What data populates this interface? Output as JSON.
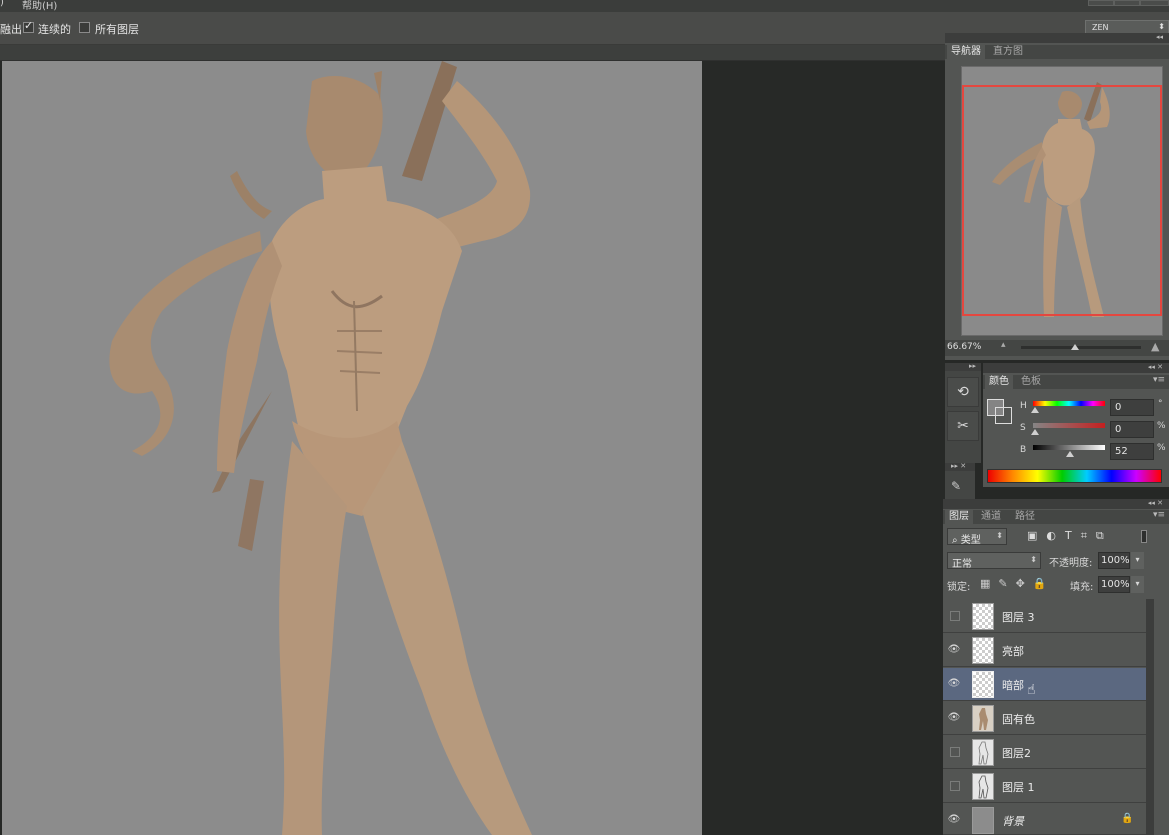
{
  "menubar": {
    "item_partial": ")",
    "help": "帮助(H)"
  },
  "options": {
    "partial": "融出",
    "contiguous": "连续的",
    "all_layers": "所有图层"
  },
  "workspace": "ZEN",
  "navigator": {
    "tab_navigator": "导航器",
    "tab_histogram": "直方图",
    "zoom": "66.67%"
  },
  "color_panel": {
    "tab_color": "颜色",
    "tab_swatches": "色板",
    "h_label": "H",
    "h_value": "0",
    "h_unit": "°",
    "s_label": "S",
    "s_value": "0",
    "s_unit": "%",
    "b_label": "B",
    "b_value": "52",
    "b_unit": "%",
    "b_level": 0.52
  },
  "layers_panel": {
    "tab_layers": "图层",
    "tab_channels": "通道",
    "tab_paths": "路径",
    "filter_kind": "类型",
    "blend_mode": "正常",
    "opacity_label": "不透明度:",
    "opacity_value": "100%",
    "lock_label": "锁定:",
    "fill_label": "填充:",
    "fill_value": "100%",
    "layers": [
      {
        "name": "图层 3",
        "visible": false,
        "thumb": "transparent"
      },
      {
        "name": "亮部",
        "visible": true,
        "thumb": "transparent"
      },
      {
        "name": "暗部",
        "visible": true,
        "thumb": "transparent",
        "selected": true
      },
      {
        "name": "固有色",
        "visible": true,
        "thumb": "figure"
      },
      {
        "name": "图层2",
        "visible": false,
        "thumb": "figure"
      },
      {
        "name": "图层 1",
        "visible": false,
        "thumb": "figure"
      },
      {
        "name": "背景",
        "visible": true,
        "thumb": "solid",
        "locked": true
      }
    ]
  },
  "colors": {
    "canvas_bg": "#8c8c8c",
    "skin": "#b89a7c",
    "nav_frame": "#e4473f",
    "selected_layer": "#5b6880"
  }
}
